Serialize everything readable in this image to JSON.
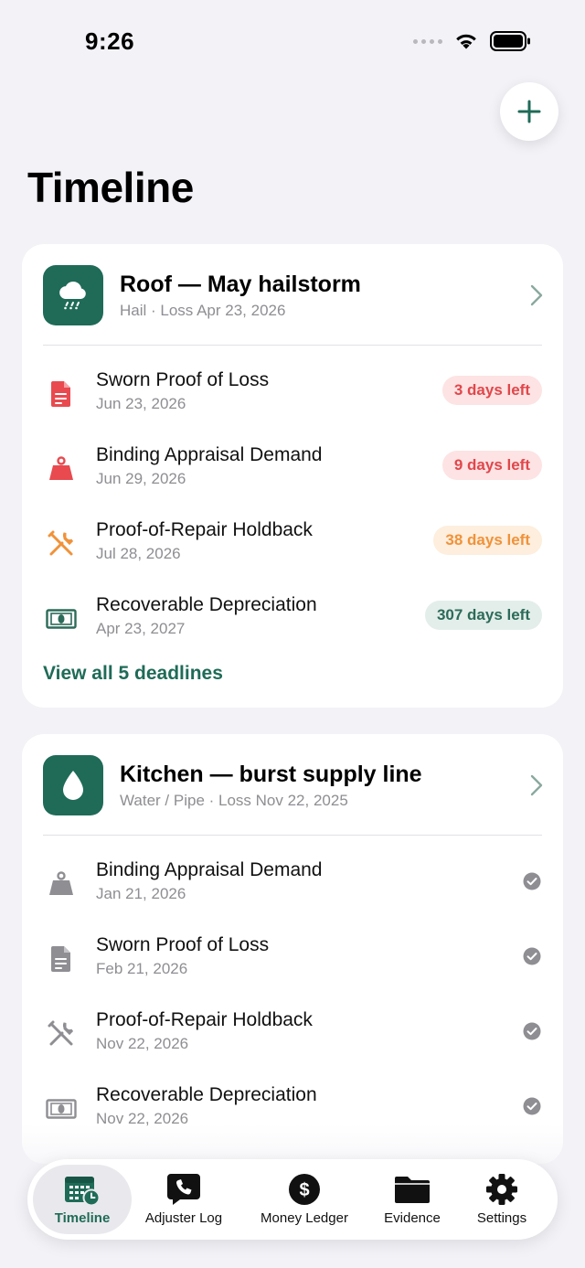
{
  "status_bar": {
    "time": "9:26"
  },
  "page": {
    "title": "Timeline"
  },
  "claims": [
    {
      "title": "Roof — May hailstorm",
      "subtitle": "Hail · Loss Apr 23, 2026",
      "icon": "cloud-hail-icon",
      "deadlines": [
        {
          "title": "Sworn Proof of Loss",
          "date": "Jun 23, 2026",
          "badge": "3 days left",
          "icon": "document-icon",
          "color": "#e0474c"
        },
        {
          "title": "Binding Appraisal Demand",
          "date": "Jun 29, 2026",
          "badge": "9 days left",
          "icon": "scale-weight-icon",
          "color": "#e0474c"
        },
        {
          "title": "Proof-of-Repair Holdback",
          "date": "Jul 28, 2026",
          "badge": "38 days left",
          "icon": "tools-icon",
          "color": "#f0923a"
        },
        {
          "title": "Recoverable Depreciation",
          "date": "Apr 23, 2027",
          "badge": "307 days left",
          "icon": "banknote-icon",
          "color": "#2c6b59"
        }
      ],
      "view_all_label": "View all 5 deadlines"
    },
    {
      "title": "Kitchen — burst supply line",
      "subtitle": "Water / Pipe · Loss Nov 22, 2025",
      "icon": "water-drop-icon",
      "deadlines": [
        {
          "title": "Binding Appraisal Demand",
          "date": "Jan 21, 2026",
          "icon": "scale-weight-icon",
          "status": "done"
        },
        {
          "title": "Sworn Proof of Loss",
          "date": "Feb 21, 2026",
          "icon": "document-icon",
          "status": "done"
        },
        {
          "title": "Proof-of-Repair Holdback",
          "date": "Nov 22, 2026",
          "icon": "tools-icon",
          "status": "done"
        },
        {
          "title": "Recoverable Depreciation",
          "date": "Nov 22, 2026",
          "icon": "banknote-icon",
          "status": "done"
        }
      ]
    }
  ],
  "tabs": [
    {
      "label": "Timeline",
      "icon": "calendar-clock-icon",
      "active": true
    },
    {
      "label": "Adjuster Log",
      "icon": "phone-bubble-icon",
      "active": false
    },
    {
      "label": "Money Ledger",
      "icon": "dollar-circle-icon",
      "active": false
    },
    {
      "label": "Evidence",
      "icon": "folder-icon",
      "active": false
    },
    {
      "label": "Settings",
      "icon": "gear-icon",
      "active": false
    }
  ],
  "colors": {
    "accent": "#1f6b57",
    "urgent": "#e0474c",
    "warning": "#f0923a",
    "background": "#f2f2f7"
  }
}
